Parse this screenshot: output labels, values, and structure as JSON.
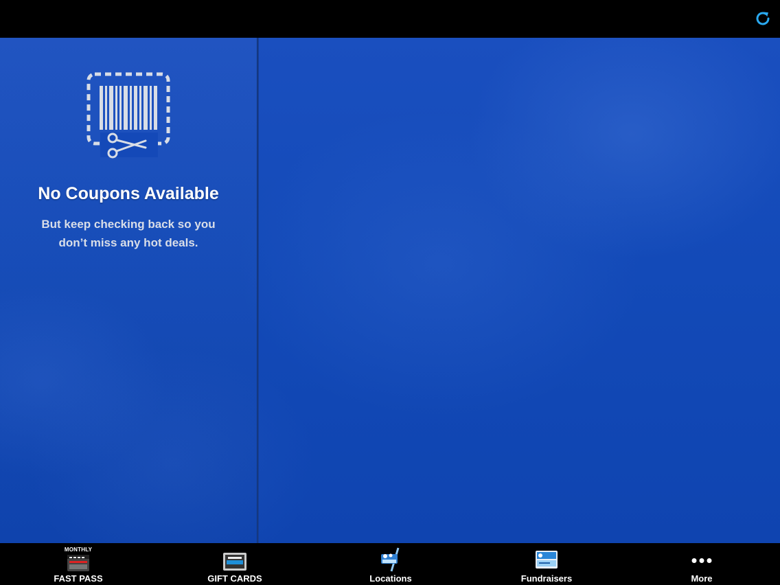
{
  "topbar": {
    "refresh_icon": "refresh-icon"
  },
  "coupons": {
    "icon": "coupon-barcode-scissors-icon",
    "title": "No Coupons Available",
    "message_line1": "But keep checking back so you",
    "message_line2": "don’t miss any hot deals."
  },
  "tabs": [
    {
      "label": "FAST PASS",
      "badge": "MONTHLY",
      "icon": "fast-pass-card-icon"
    },
    {
      "label": "GIFT CARDS",
      "icon": "gift-card-icon"
    },
    {
      "label": "Locations",
      "icon": "location-carwash-icon"
    },
    {
      "label": "Fundraisers",
      "icon": "fundraiser-card-icon"
    },
    {
      "label": "More",
      "icon": "more-dots-icon"
    }
  ],
  "colors": {
    "accent": "#2aa9f0",
    "background_blue": "#1449b8",
    "bar_black": "#000000"
  }
}
